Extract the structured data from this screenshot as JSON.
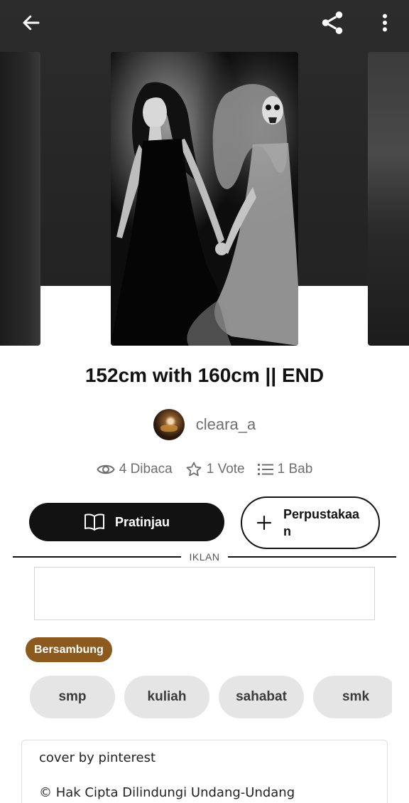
{
  "header": {
    "back_icon": "arrow-left-icon",
    "share_icon": "share-icon",
    "menu_icon": "more-vertical-icon"
  },
  "story": {
    "title": "152cm with 160cm || END",
    "author": "cleara_a",
    "stats": {
      "reads": "4 Dibaca",
      "votes": "1 Vote",
      "parts": "1 Bab"
    }
  },
  "actions": {
    "preview_label": "Pratinjau",
    "library_label": "Perpustakaan"
  },
  "ad": {
    "label": "IKLAN"
  },
  "status": {
    "label": "Bersambung",
    "color": "#8c5a1e"
  },
  "tags": [
    "smp",
    "kuliah",
    "sahabat",
    "smk"
  ],
  "description": {
    "line1": "cover by pinterest",
    "line2": "© Hak Cipta Dilindungi Undang-Undang"
  },
  "colors": {
    "header_bg": "#262626",
    "primary_button": "#121212",
    "tag_bg": "#e5e5e5"
  }
}
